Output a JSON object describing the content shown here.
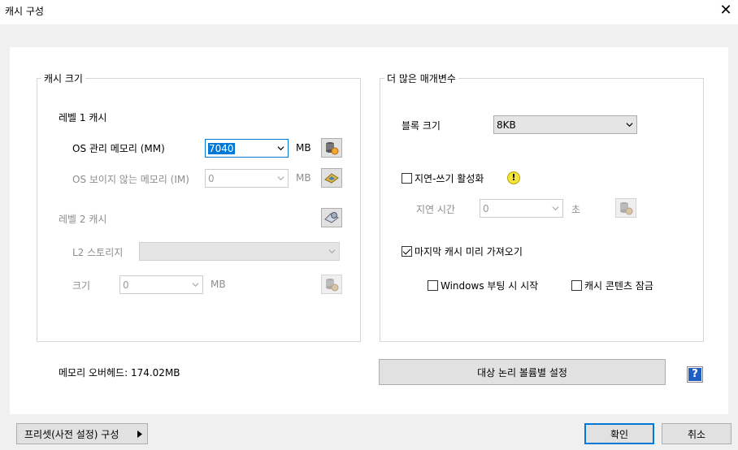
{
  "window": {
    "title": "캐시 구성",
    "close_glyph": "✕"
  },
  "cache_size": {
    "legend": "캐시 크기",
    "level1_label": "레벨 1 캐시",
    "os_managed_label": "OS 관리 메모리 (MM)",
    "os_managed_value": "7040",
    "os_managed_unit": "MB",
    "os_invisible_label": "OS 보이지 않는 메모리 (IM)",
    "os_invisible_value": "0",
    "os_invisible_unit": "MB",
    "level2_label": "레벨 2 캐시",
    "l2_storage_label": "L2 스토리지",
    "l2_storage_value": "",
    "size_label": "크기",
    "size_value": "0",
    "size_unit": "MB"
  },
  "more_params": {
    "legend": "더 많은 매개변수",
    "block_size_label": "블록 크기",
    "block_size_value": "8KB",
    "lazy_write_label": "지연-쓰기 활성화",
    "lazy_write_checked": false,
    "delay_label": "지연 시간",
    "delay_value": "0",
    "delay_unit": "초",
    "prefetch_label": "마지막 캐시 미리 가져오기",
    "prefetch_checked": true,
    "start_on_boot_label": "Windows 부팅 시 시작",
    "start_on_boot_checked": false,
    "lock_content_label": "캐시 콘텐츠 잠금",
    "lock_content_checked": false
  },
  "memory_overhead": "메모리 오버헤드: 174.02MB",
  "target_volume_button": "대상 논리 볼륨별 설정",
  "help_glyph": "?",
  "footer": {
    "preset_button": "프리셋(사전 설정) 구성",
    "ok_button": "확인",
    "cancel_button": "취소"
  },
  "colors": {
    "accent": "#0078d7",
    "window_bg": "#f0f0f0",
    "panel_bg": "#ffffff"
  }
}
